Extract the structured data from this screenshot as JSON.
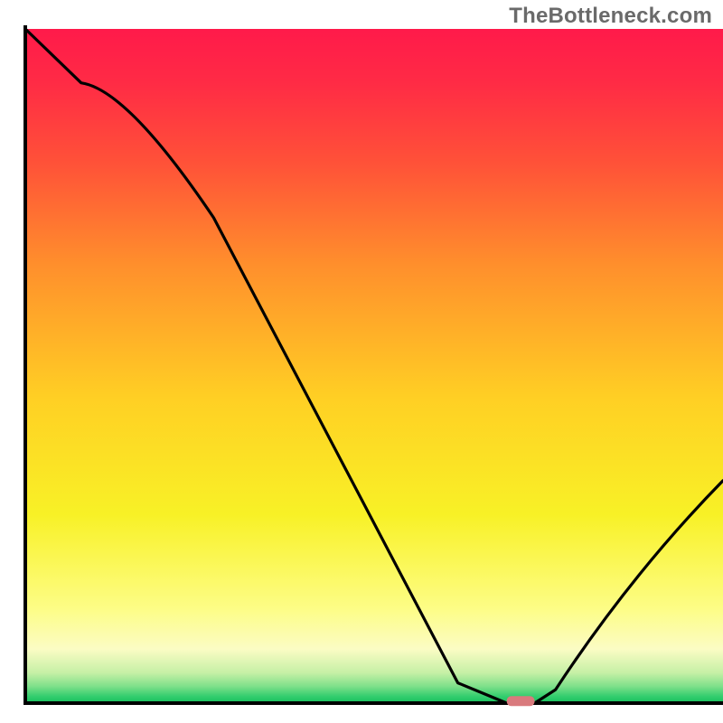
{
  "watermark": "TheBottleneck.com",
  "chart_data": {
    "type": "line",
    "title": "",
    "xlabel": "",
    "ylabel": "",
    "xlim": [
      0,
      100
    ],
    "ylim": [
      0,
      100
    ],
    "grid": false,
    "series": [
      {
        "name": "bottleneck-curve",
        "x": [
          0,
          8,
          27,
          62,
          69,
          73,
          76,
          100
        ],
        "y": [
          100,
          92,
          72,
          3,
          0,
          0,
          2,
          33
        ]
      }
    ],
    "marker": {
      "name": "optimal-range",
      "x_start": 69,
      "x_end": 73,
      "y": 0.3,
      "color": "#d97a7d"
    },
    "gradient_stops": [
      {
        "offset": 0.0,
        "color": "#ff1a4a"
      },
      {
        "offset": 0.08,
        "color": "#ff2b45"
      },
      {
        "offset": 0.2,
        "color": "#ff5238"
      },
      {
        "offset": 0.35,
        "color": "#ff8f2c"
      },
      {
        "offset": 0.55,
        "color": "#ffd024"
      },
      {
        "offset": 0.72,
        "color": "#f8f126"
      },
      {
        "offset": 0.86,
        "color": "#fdfd86"
      },
      {
        "offset": 0.92,
        "color": "#fbfcc4"
      },
      {
        "offset": 0.955,
        "color": "#c6f0a6"
      },
      {
        "offset": 0.975,
        "color": "#7fe08a"
      },
      {
        "offset": 0.99,
        "color": "#33cd6e"
      },
      {
        "offset": 1.0,
        "color": "#17c05d"
      }
    ],
    "axis_color": "#000000",
    "line_color": "#000000"
  }
}
